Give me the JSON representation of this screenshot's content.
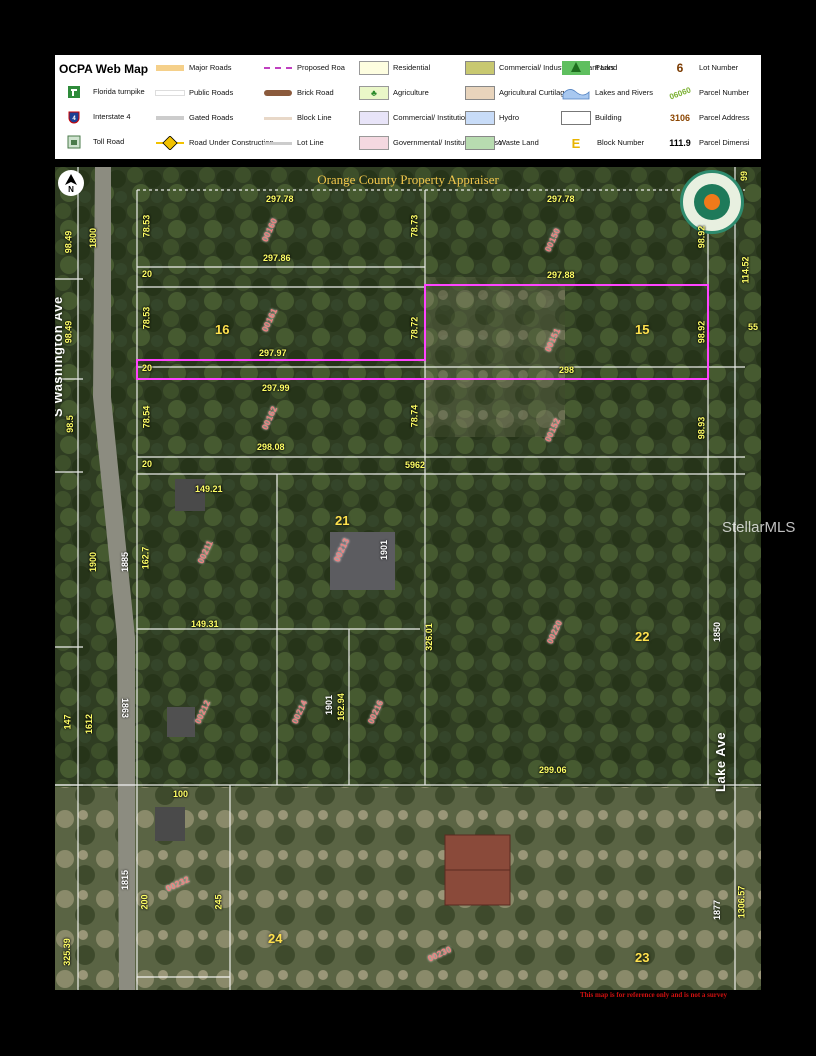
{
  "legend": {
    "title": "OCPA Web Map",
    "items": [
      {
        "id": "florida-turnpike",
        "label": "Florida turnpike",
        "icon": "turnpike-shield-icon",
        "color": "#2e8b3a"
      },
      {
        "id": "interstate-4",
        "label": "Interstate 4",
        "icon": "interstate-shield-icon",
        "color": "#1c3f94"
      },
      {
        "id": "toll-road",
        "label": "Toll Road",
        "icon": "toll-road-icon",
        "color": "#4a7a4a"
      },
      {
        "id": "major-roads",
        "label": "Major Roads",
        "color": "#f5d08a"
      },
      {
        "id": "public-roads",
        "label": "Public Roads",
        "color": "#ffffff"
      },
      {
        "id": "gated-roads",
        "label": "Gated Roads",
        "color": "#cccccc"
      },
      {
        "id": "road-under-construction",
        "label": "Road Under Construction",
        "icon": "construction-icon",
        "color": "#f2c200"
      },
      {
        "id": "proposed-road",
        "label": "Proposed Roa",
        "color": "#c040c0"
      },
      {
        "id": "brick-road",
        "label": "Brick Road",
        "color": "#8b5a3c"
      },
      {
        "id": "block-line",
        "label": "Block Line",
        "color": "#e8d8c8"
      },
      {
        "id": "lot-line",
        "label": "Lot Line",
        "color": "#cccccc"
      },
      {
        "id": "residential",
        "label": "Residential",
        "color": "#fefee0"
      },
      {
        "id": "agriculture",
        "label": "Agriculture",
        "color": "#eaf7c8"
      },
      {
        "id": "commercial-institutional",
        "label": "Commercial/ Institutional",
        "color": "#e8e4f8"
      },
      {
        "id": "governmental",
        "label": "Governmental/ Institutional/ Misc",
        "color": "#f4d8e0"
      },
      {
        "id": "commercial-industrial-vacant",
        "label": "Commercial/ Industrial Vacant Land",
        "color": "#c8c870"
      },
      {
        "id": "agricultural-curtilage",
        "label": "Agricultural Curtilage",
        "color": "#e8d4bc"
      },
      {
        "id": "hydro",
        "label": "Hydro",
        "color": "#c8dcf8"
      },
      {
        "id": "waste-land",
        "label": "Waste Land",
        "color": "#b8dcb0"
      },
      {
        "id": "parks",
        "label": "Parks",
        "icon": "parks-tree-icon",
        "color": "#2e9b3a"
      },
      {
        "id": "lakes-rivers",
        "label": "Lakes and Rivers",
        "icon": "lake-icon",
        "color": "#a8c8f0"
      },
      {
        "id": "building",
        "label": "Building",
        "color": "#ffffff"
      },
      {
        "id": "block-number",
        "label": "Block Number",
        "sample": "E",
        "color": "#e8b400"
      },
      {
        "id": "lot-number",
        "label": "Lot Number",
        "sample": "6",
        "color": "#7a3a00"
      },
      {
        "id": "parcel-number",
        "label": "Parcel Number",
        "sample": "06060",
        "color": "#7ab030"
      },
      {
        "id": "parcel-address",
        "label": "Parcel Address",
        "sample": "3106",
        "color": "#8b4500"
      },
      {
        "id": "parcel-dimension",
        "label": "Parcel Dimensi",
        "sample": "111.9",
        "color": "#000000"
      }
    ]
  },
  "map": {
    "title": "Orange County Property Appraiser",
    "north_label": "N",
    "roads": [
      "S Washington Ave",
      "Lake Ave"
    ],
    "lots": [
      "16",
      "15",
      "21",
      "22",
      "24",
      "23"
    ],
    "parcels": [
      "00160",
      "00150",
      "00161",
      "00151",
      "00162",
      "00152",
      "00211",
      "00213",
      "00220",
      "00212",
      "00214",
      "00216",
      "00232",
      "00230"
    ],
    "addresses": [
      "1901",
      "1901",
      "1863",
      "1815",
      "1885",
      "1850",
      "1877"
    ],
    "dimensions": [
      "297.78",
      "297.78",
      "78.53",
      "78.73",
      "297.86",
      "20",
      "297.88",
      "78.53",
      "78.72",
      "98.92",
      "297.97",
      "298",
      "20",
      "297.99",
      "78.54",
      "78.74",
      "98.93",
      "298.08",
      "20",
      "5962",
      "149.21",
      "162.7",
      "149.31",
      "326.01",
      "162.94",
      "299.06",
      "100",
      "200",
      "245",
      "1306.57",
      "114.52",
      "98.49",
      "98.49",
      "98.5",
      "1800",
      "1900",
      "147",
      "1612",
      "55",
      "99",
      "325.39",
      "98.92"
    ],
    "highlight_color": "#ff44ff",
    "disclaimer": "This map is for reference only and is not a survey"
  },
  "watermark": "StellarMLS"
}
